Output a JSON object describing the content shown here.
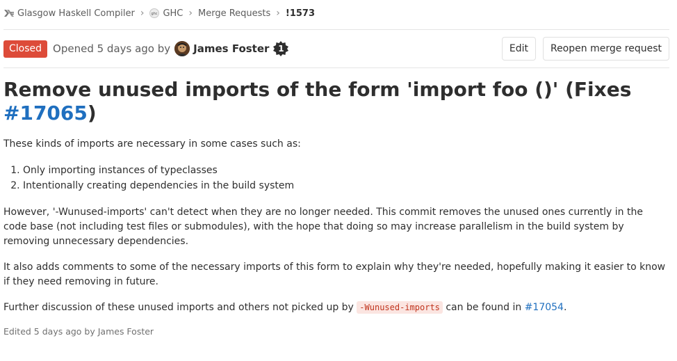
{
  "breadcrumb": {
    "group": "Glasgow Haskell Compiler",
    "project": "GHC",
    "section": "Merge Requests",
    "current": "!1573"
  },
  "header": {
    "status": "Closed",
    "opened_prefix": "Opened 5 days ago by",
    "author": "James Foster",
    "author_badge": "1",
    "edit_label": "Edit",
    "reopen_label": "Reopen merge request"
  },
  "title": {
    "text": "Remove unused imports of the form 'import foo ()' (Fixes",
    "link": "#17065",
    "suffix": ")"
  },
  "description": {
    "intro": "These kinds of imports are necessary in some cases such as:",
    "list": [
      "Only importing instances of typeclasses",
      "Intentionally creating dependencies in the build system"
    ],
    "para1": "However, '-Wunused-imports' can't detect when they are no longer needed. This commit removes the unused ones currently in the code base (not including test files or submodules), with the hope that doing so may increase parallelism in the build system by removing unnecessary dependencies.",
    "para2": "It also adds comments to some of the necessary imports of this form to explain why they're needed, hopefully making it easier to know if they need removing in future.",
    "para3_prefix": "Further discussion of these unused imports and others not picked up by",
    "para3_code": "-Wunused-imports",
    "para3_middle": "can be found in",
    "para3_link": "#17054",
    "para3_suffix": "."
  },
  "edited": "Edited 5 days ago by James Foster",
  "colors": {
    "closed_badge": "#dd4b39",
    "link": "#1f6fbf",
    "code_text": "#c0341d",
    "code_bg": "#fbe5e1"
  }
}
